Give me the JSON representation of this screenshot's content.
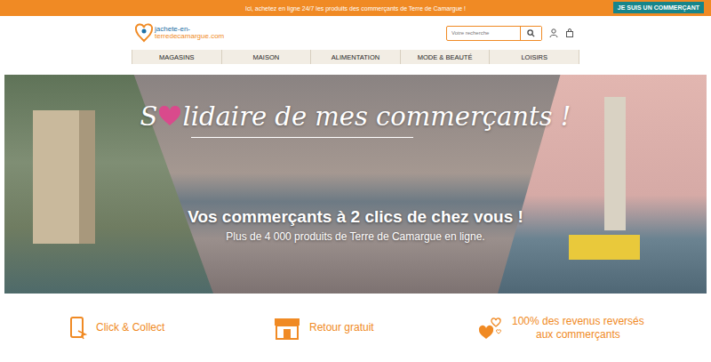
{
  "topbar": {
    "message": "Ici, achetez en ligne 24/7 les produits des commerçants de Terre de Camargue !",
    "merchant_button": "JE SUIS UN COMMERÇANT"
  },
  "header": {
    "logo": {
      "line1": "jachete-en-",
      "line2": "terredecamargue.com"
    },
    "search": {
      "placeholder": "Votre recherche"
    }
  },
  "nav": [
    "MAGASINS",
    "MAISON",
    "ALIMENTATION",
    "MODE & BEAUTÉ",
    "LOISIRS"
  ],
  "banner": {
    "title_start": "S",
    "title_end": "lidaire de mes commerçants !",
    "headline": "Vos commerçants à 2 clics de chez vous !",
    "subline": "Plus de 4 000 produits de Terre de Camargue en ligne."
  },
  "features": [
    {
      "kind": "phone",
      "lines": [
        "Click & Collect"
      ]
    },
    {
      "kind": "shop",
      "lines": [
        "Retour gratuit"
      ]
    },
    {
      "kind": "hearts",
      "lines": [
        "100% des revenus reversés",
        "aux commerçants"
      ]
    }
  ]
}
